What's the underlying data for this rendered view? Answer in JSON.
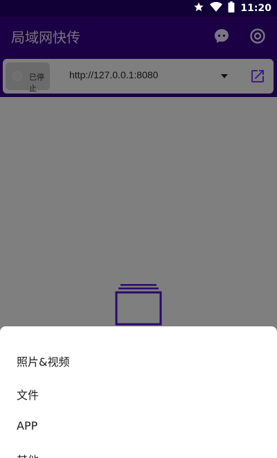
{
  "status_bar": {
    "time": "11:20"
  },
  "app_bar": {
    "title": "局域网快传"
  },
  "server": {
    "toggle_label": "已停止",
    "url": "http://127.0.0.1:8080"
  },
  "bottom_sheet": {
    "items": [
      {
        "label": "照片&视频"
      },
      {
        "label": "文件"
      },
      {
        "label": "APP"
      },
      {
        "label": "其他"
      }
    ]
  },
  "colors": {
    "app_bar": "#1b0045",
    "accent": "#3a1b8a",
    "overlay": "#7f7f7f"
  }
}
